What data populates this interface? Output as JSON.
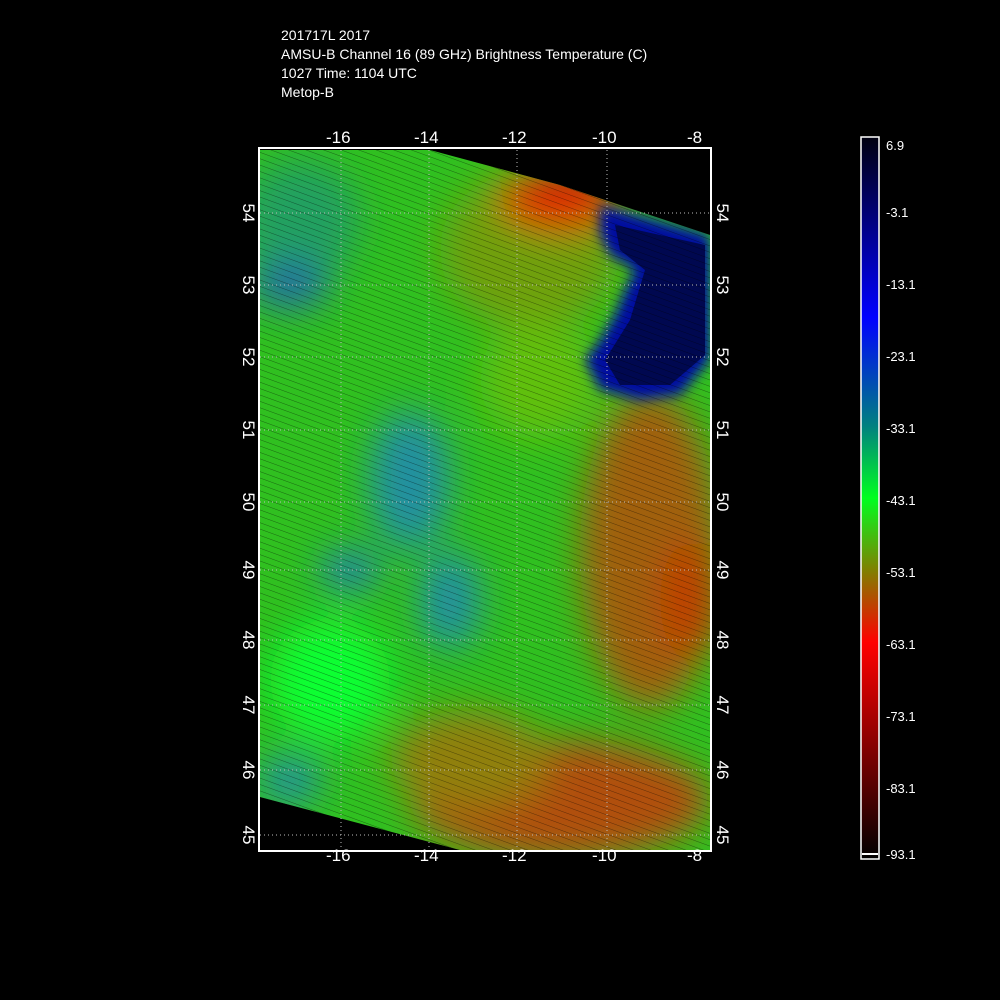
{
  "header": {
    "line1": "201717L 2017",
    "line2": "AMSU-B Channel 16 (89 GHz) Brightness Temperature (C)",
    "line3": "1027 Time: 1104 UTC",
    "line4": "Metop-B"
  },
  "map": {
    "lon_ticks": [
      "-16",
      "-14",
      "-12",
      "-10",
      "-8"
    ],
    "lat_ticks": [
      "54",
      "53",
      "52",
      "51",
      "50",
      "49",
      "48",
      "47",
      "46",
      "45"
    ],
    "lon_range": [
      -17.8,
      -7.8
    ],
    "lat_range": [
      44.8,
      54.9
    ]
  },
  "colorbar": {
    "labels": [
      "6.9",
      "-3.1",
      "-13.1",
      "-23.1",
      "-33.1",
      "-43.1",
      "-53.1",
      "-63.1",
      "-73.1",
      "-83.1",
      "-93.1"
    ],
    "range": [
      -93.1,
      6.9
    ],
    "colors": [
      "#000010",
      "#000060",
      "#0000c0",
      "#0000ff",
      "#0050a0",
      "#008080",
      "#00c060",
      "#00ff20",
      "#50a000",
      "#808000",
      "#c04000",
      "#ff0000",
      "#a00000",
      "#500000",
      "#100000"
    ]
  }
}
